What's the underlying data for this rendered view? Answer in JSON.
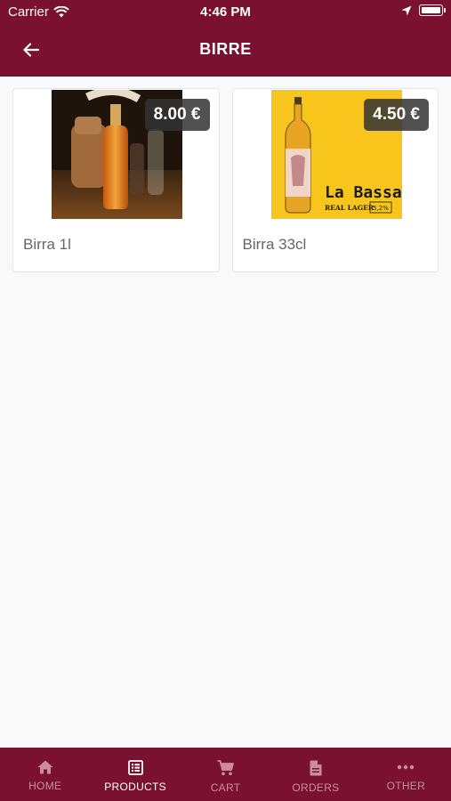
{
  "status_bar": {
    "carrier": "Carrier",
    "time": "4:46 PM"
  },
  "header": {
    "title": "BIRRE"
  },
  "products": [
    {
      "name": "Birra 1l",
      "price": "8.00 €",
      "image": "beer-bottle-1l-photo"
    },
    {
      "name": "Birra 33cl",
      "price": "4.50 €",
      "image": "la-bassa-bottle-image",
      "image_text": {
        "brand": "La Bassa",
        "sub": "REAL LAGER",
        "abv": "5,2%"
      }
    }
  ],
  "tabs": [
    {
      "label": "HOME",
      "icon": "home-icon",
      "active": false
    },
    {
      "label": "PRODUCTS",
      "icon": "products-icon",
      "active": true
    },
    {
      "label": "CART",
      "icon": "cart-icon",
      "active": false
    },
    {
      "label": "ORDERS",
      "icon": "orders-icon",
      "active": false
    },
    {
      "label": "OTHER",
      "icon": "more-icon",
      "active": false
    }
  ],
  "colors": {
    "primary": "#7a1130",
    "tab_inactive": "#c98d9e",
    "background": "#f9f9f9",
    "price_badge": "#323232"
  }
}
